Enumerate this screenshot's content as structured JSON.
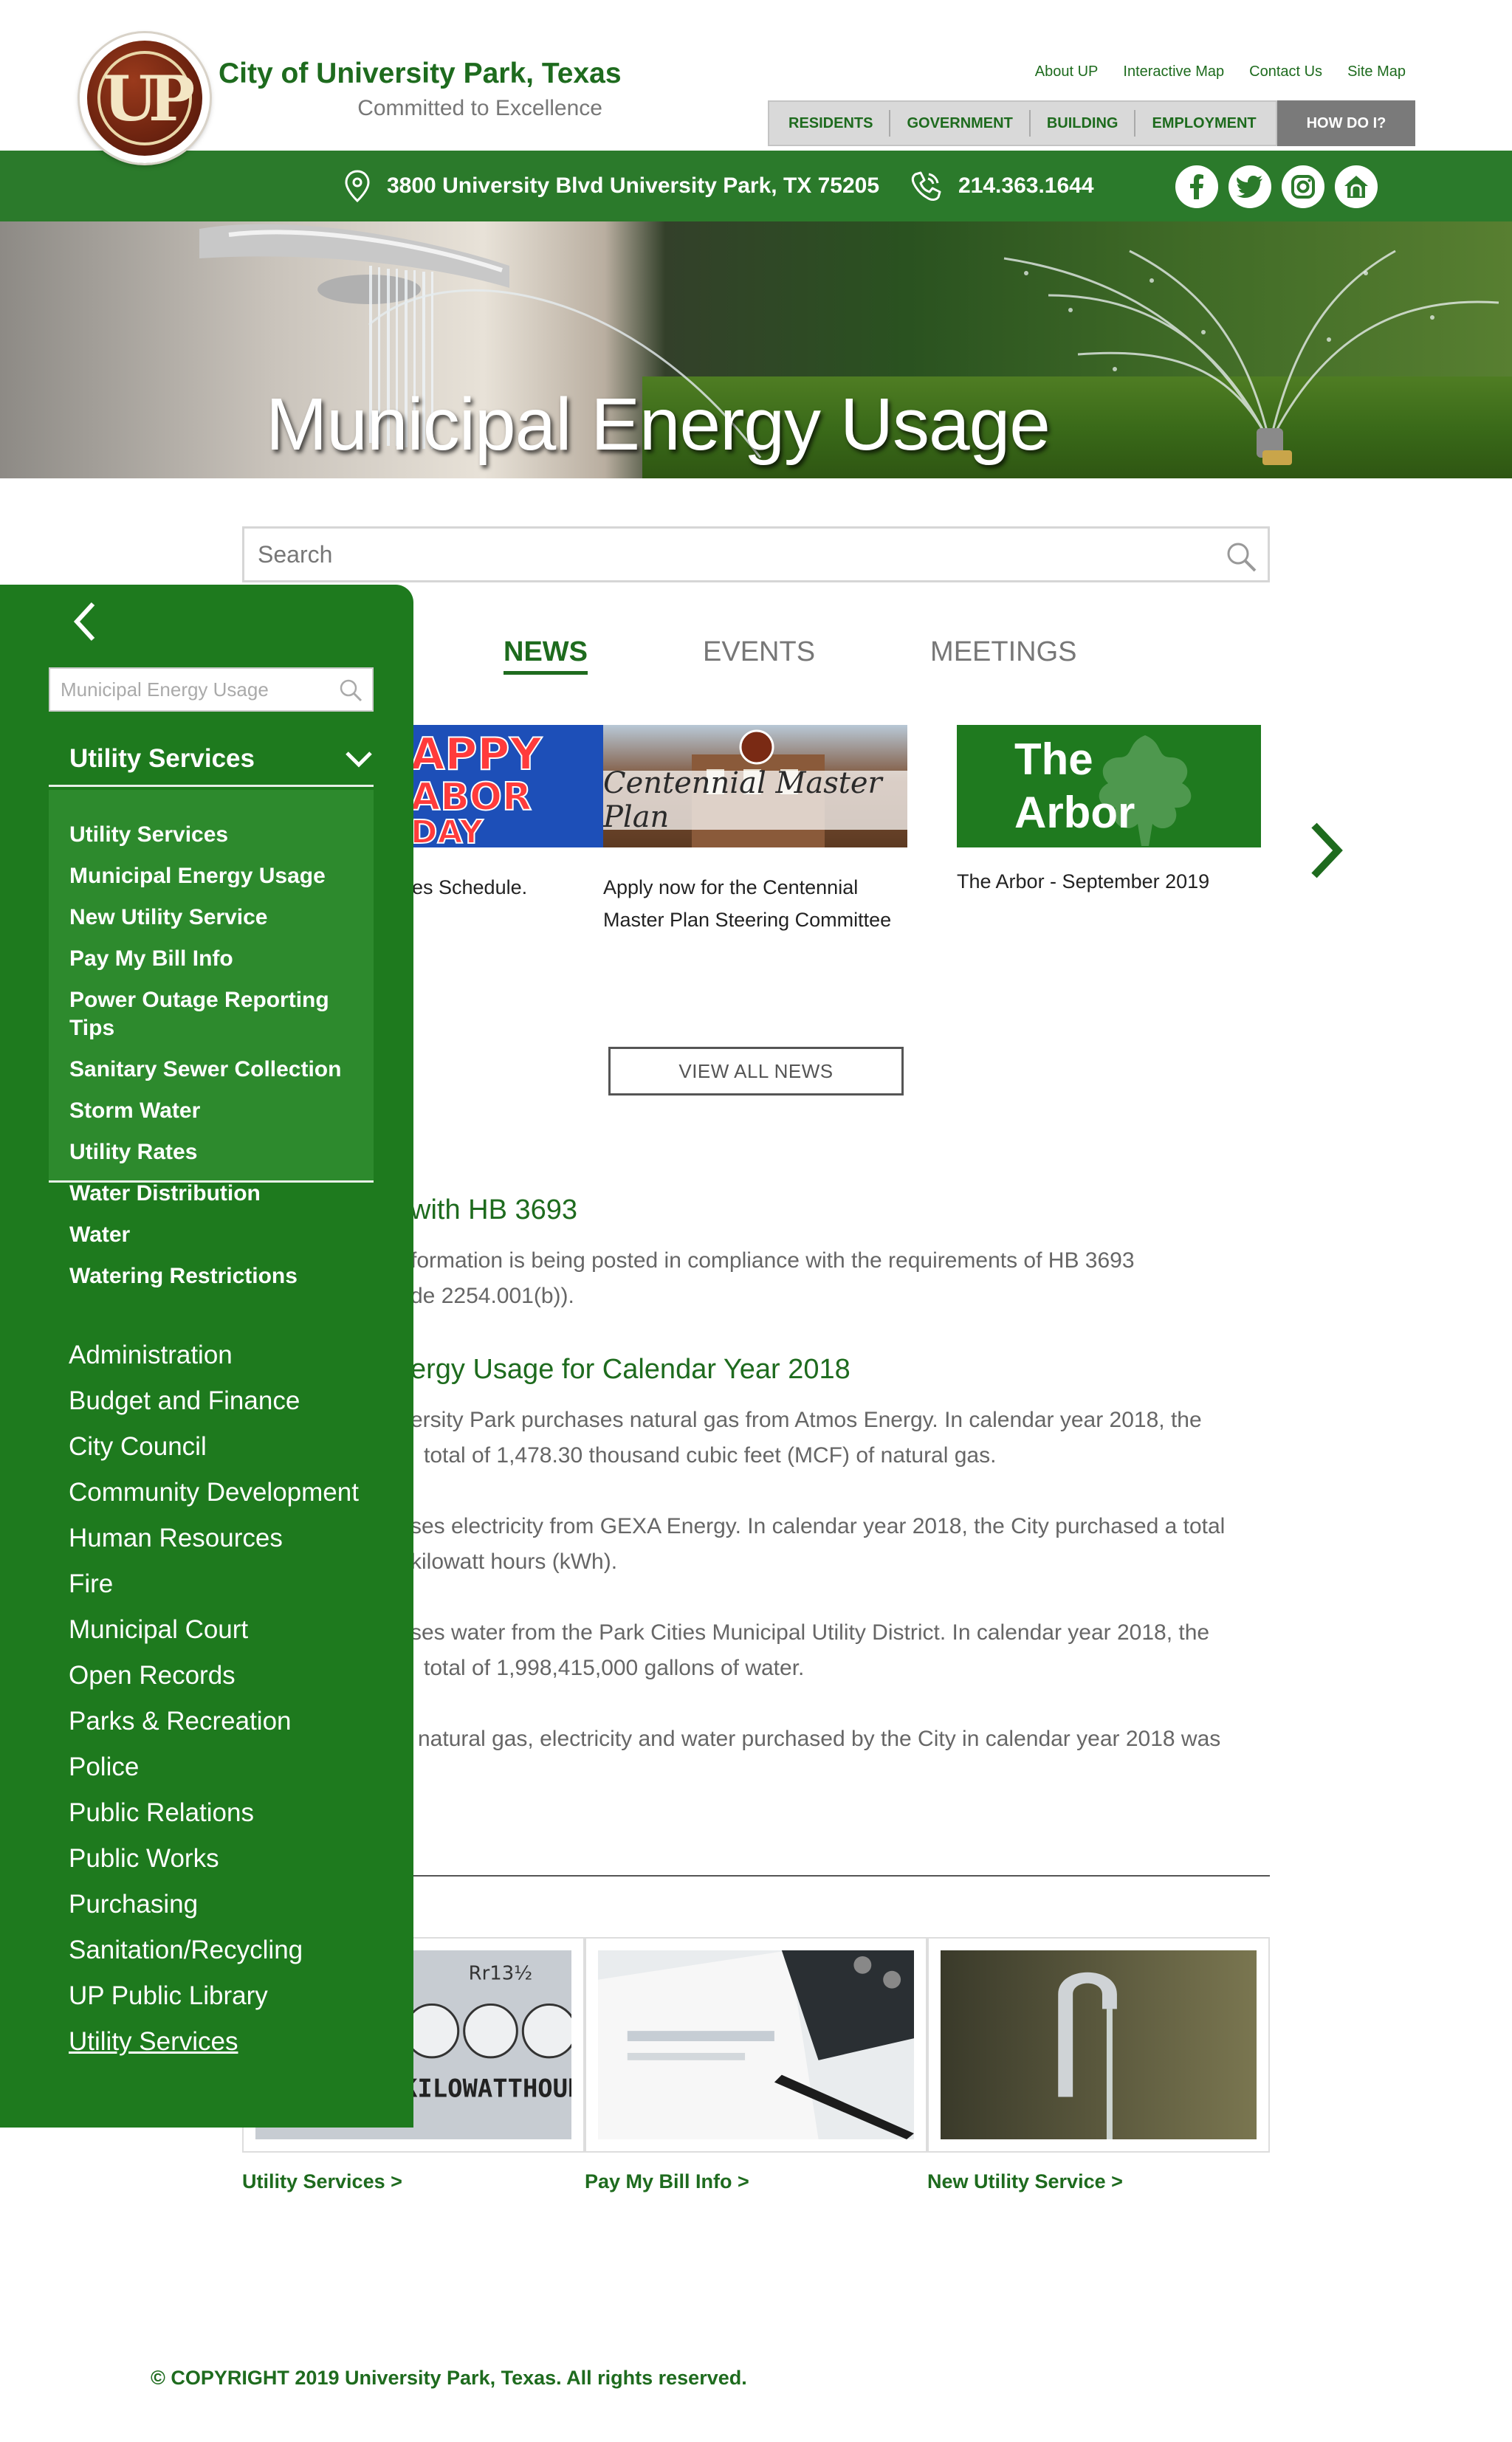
{
  "header": {
    "site_title": "City of University Park, Texas",
    "tagline": "Committed to Excellence",
    "logo_text": "UP",
    "util_links": [
      "About UP",
      "Interactive Map",
      "Contact Us",
      "Site Map"
    ],
    "nav": [
      "RESIDENTS",
      "GOVERNMENT",
      "BUILDING",
      "EMPLOYMENT"
    ],
    "how_do_i": "HOW DO I?"
  },
  "info_bar": {
    "address": "3800 University Blvd University Park, TX 75205",
    "phone": "214.363.1644",
    "socials": [
      "facebook-icon",
      "twitter-icon",
      "instagram-icon",
      "nextdoor-icon"
    ]
  },
  "hero": {
    "title": "Municipal Energy Usage"
  },
  "search": {
    "placeholder": "Search"
  },
  "tabs": [
    "NEWS",
    "EVENTS",
    "MEETINGS"
  ],
  "news": {
    "cards": [
      {
        "image_text": "APPY ABOR DAY",
        "caption": "es Schedule."
      },
      {
        "image_text": "Centennial Master Plan",
        "caption_line1": "Apply now for the Centennial",
        "caption_line2": "Master Plan Steering Committee"
      },
      {
        "image_text_line1": "The",
        "image_text_line2": "Arbor",
        "caption": "The Arbor - September 2019"
      }
    ],
    "view_all": "VIEW ALL NEWS"
  },
  "content": {
    "h1": "with HB 3693",
    "p1_line1": "formation is being posted in compliance with the requirements of HB 3693",
    "p1_line2": "de 2254.001(b)).",
    "h2": "ergy Usage for Calendar Year 2018",
    "p2_line1": "ersity Park purchases natural gas from Atmos Energy.  In calendar year 2018, the",
    "p2_line2": "total of 1,478.30 thousand cubic feet (MCF) of natural gas.",
    "p3_line1": "ses electricity from GEXA Energy.  In calendar year 2018, the City purchased a total",
    "p3_line2": "kilowatt hours (kWh).",
    "p4_line1": "ses water from the Park Cities Municipal Utility District.  In calendar year 2018, the",
    "p4_line2": "total of 1,998,415,000 gallons of water.",
    "p5_line1": "natural gas, electricity and water purchased by the City in calendar year 2018 was"
  },
  "quick_links": [
    {
      "label": "Utility Services >",
      "image_text": "KILOWATTHOURS"
    },
    {
      "label": "Pay My Bill Info >"
    },
    {
      "label": "New Utility Service >"
    }
  ],
  "footer": {
    "copyright": "© COPYRIGHT 2019 University Park, Texas. All rights reserved."
  },
  "sidebar": {
    "search_placeholder": "Municipal Energy Usage",
    "section_title": "Utility Services",
    "sub_items": [
      "Utility Services",
      "Municipal Energy Usage",
      "New Utility Service",
      "Pay My Bill Info",
      "Power Outage Reporting Tips",
      "Sanitary Sewer Collection",
      "Storm Water",
      "Utility Rates",
      "Water Distribution",
      "Water",
      "Watering Restrictions"
    ],
    "items": [
      "Administration",
      "Budget and Finance",
      "City Council",
      "Community Development",
      "Human Resources",
      "Fire",
      "Municipal Court",
      "Open Records",
      "Parks & Recreation",
      "Police",
      "Public Relations",
      "Public Works",
      "Purchasing",
      "Sanitation/Recycling",
      "UP Public Library",
      "Utility Services"
    ]
  },
  "colors": {
    "brand_green": "#1e7a1e",
    "link_green": "#1e6b1e",
    "nav_gray": "#d9d9d9",
    "howdo_gray": "#7a7a7a"
  }
}
